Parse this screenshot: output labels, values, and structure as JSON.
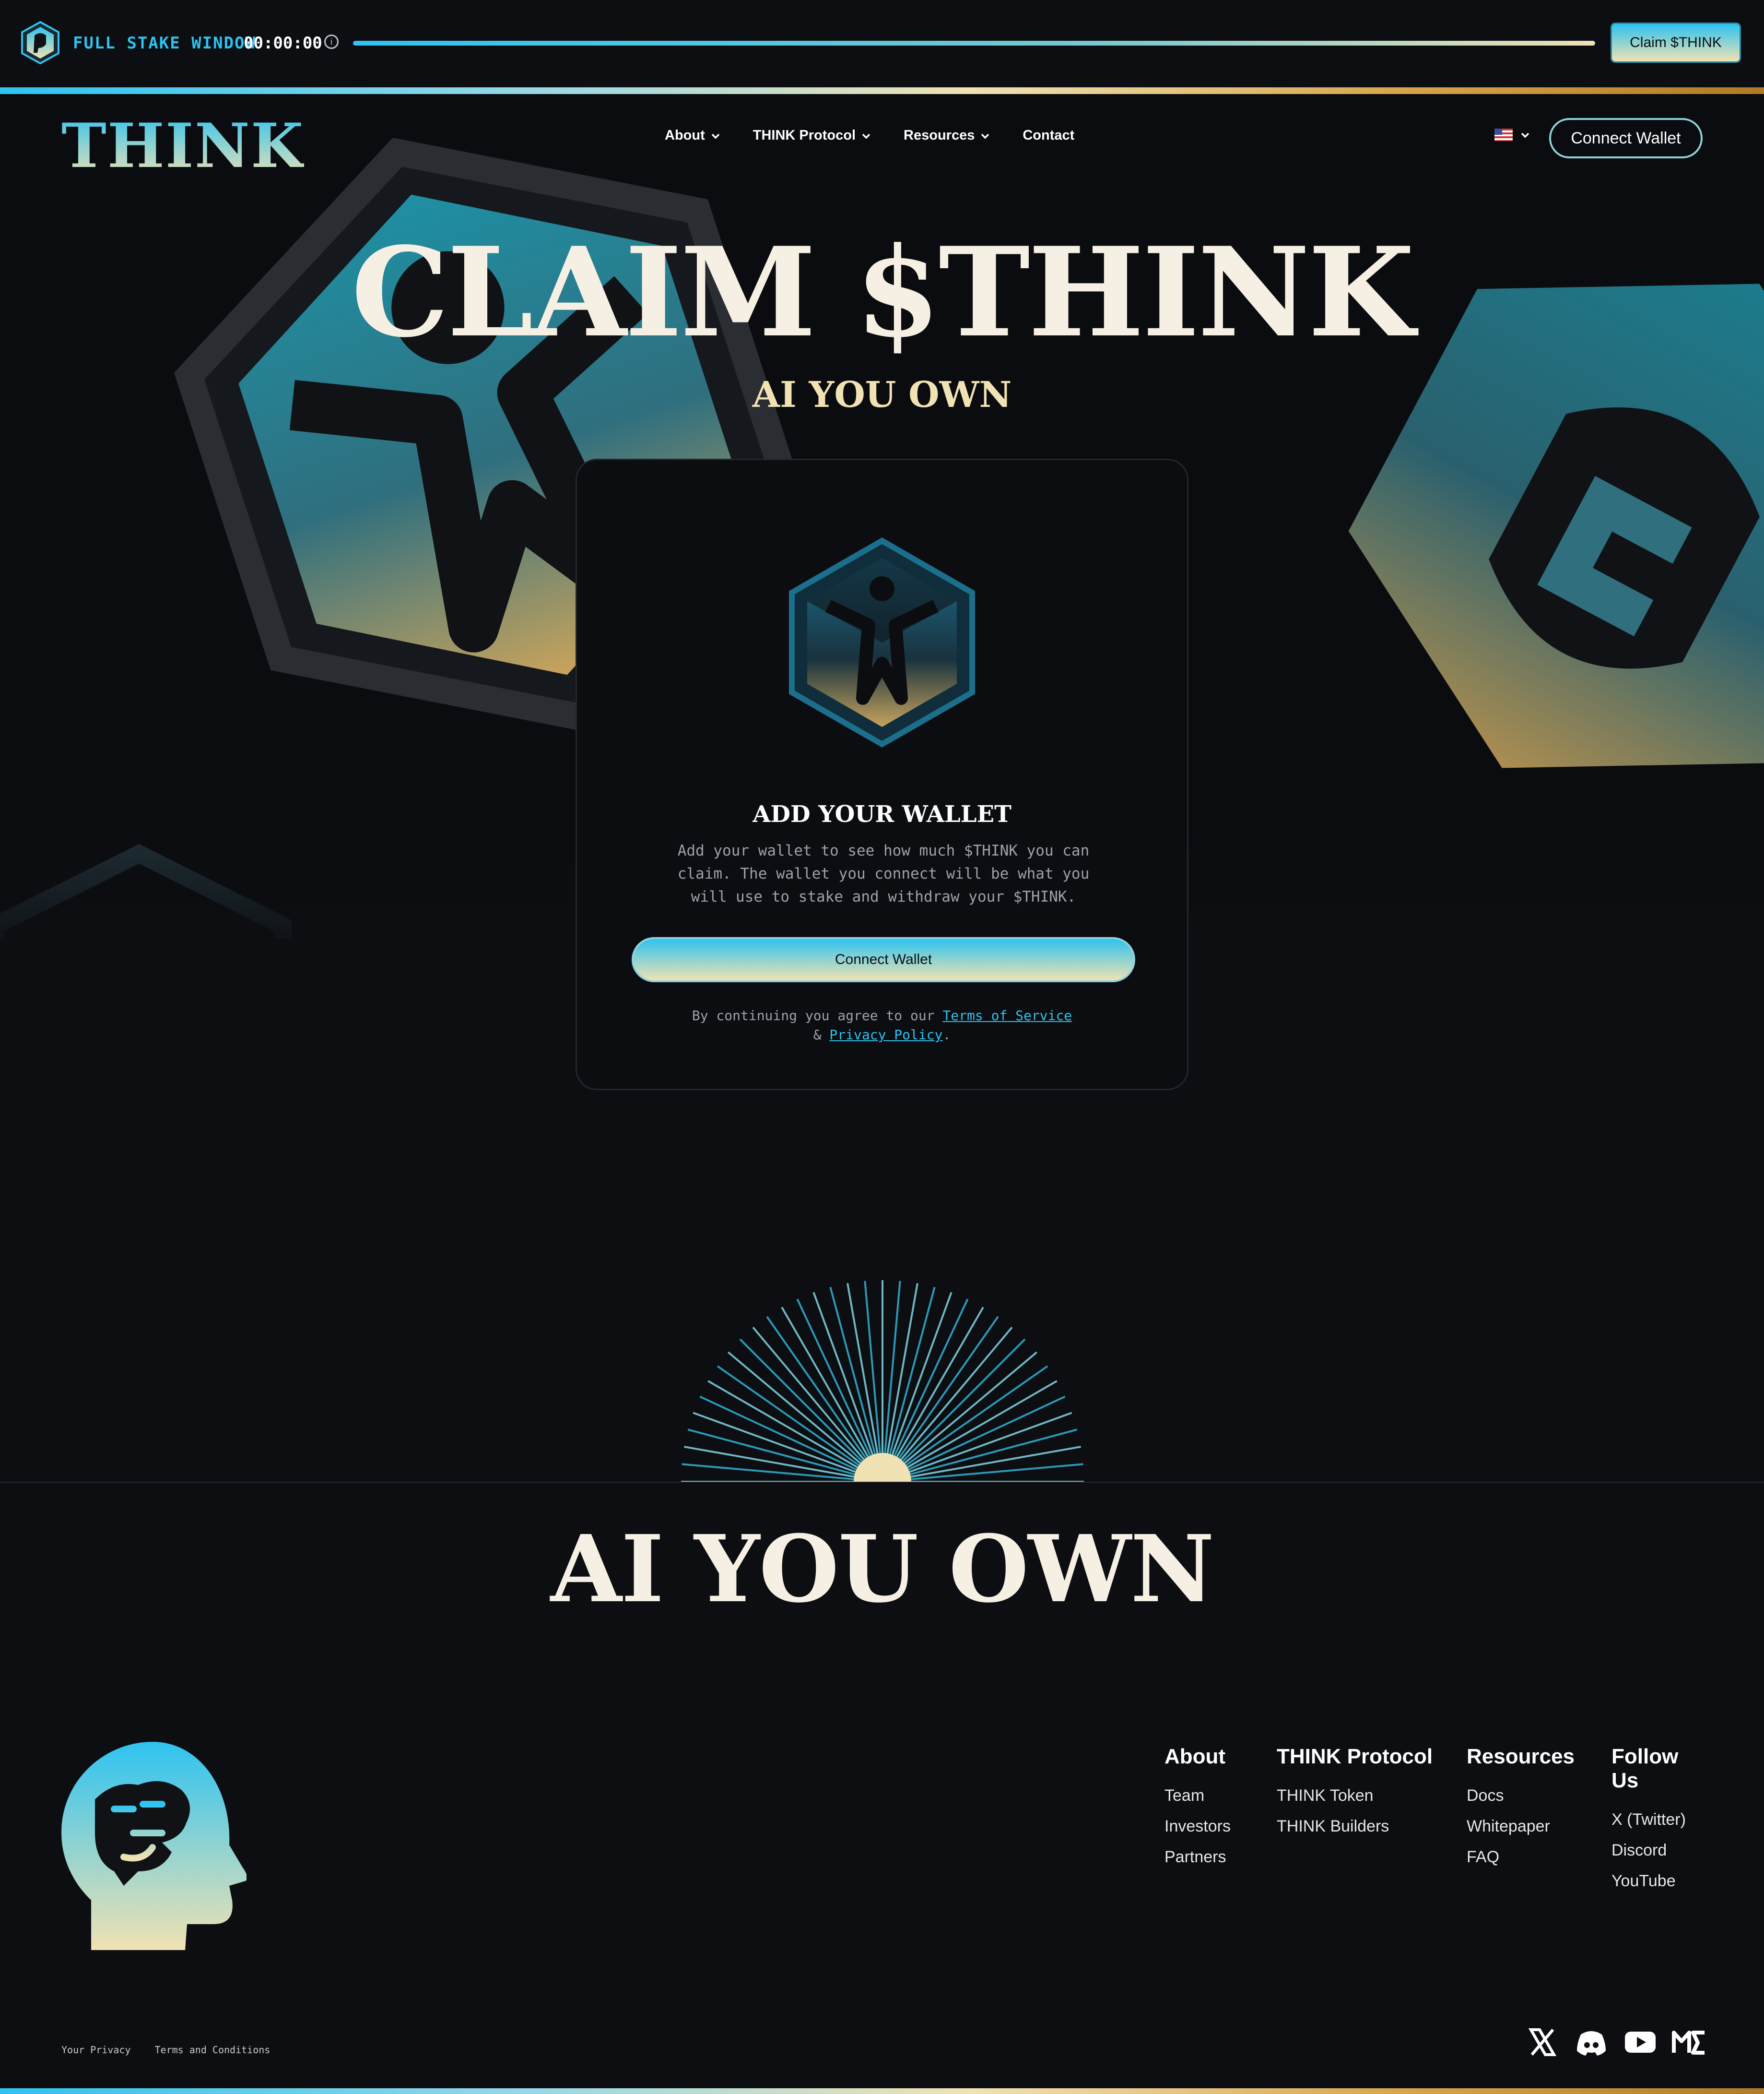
{
  "stake_bar": {
    "label": "FULL STAKE WINDOW",
    "timer": "00:00:00",
    "info_glyph": "i",
    "claim_button": "Claim $THINK",
    "progress": 1.0
  },
  "nav": {
    "brand": "THINK",
    "items": [
      {
        "label": "About",
        "has_dropdown": true
      },
      {
        "label": "THINK Protocol",
        "has_dropdown": true
      },
      {
        "label": "Resources",
        "has_dropdown": true
      },
      {
        "label": "Contact",
        "has_dropdown": false
      }
    ],
    "language_icon": "us-flag-icon",
    "connect_button": "Connect Wallet"
  },
  "hero": {
    "title": "CLAIM $THINK",
    "subtitle": "AI YOU OWN"
  },
  "card": {
    "icon": "think-hex-person-icon",
    "title": "ADD YOUR WALLET",
    "text": "Add your wallet to see how much $THINK you can claim. The wallet you connect will be what you will use to stake and withdraw your $THINK.",
    "button": "Connect Wallet",
    "legal_prefix": "By continuing you agree to our",
    "terms_link": "Terms of Service",
    "legal_mid": "&",
    "privacy_link": "Privacy Policy",
    "legal_suffix": "."
  },
  "tagline": "AI YOU OWN",
  "footer": {
    "columns": [
      {
        "title": "About",
        "links": [
          "Team",
          "Investors",
          "Partners"
        ]
      },
      {
        "title": "THINK Protocol",
        "links": [
          "THINK Token",
          "THINK Builders"
        ]
      },
      {
        "title": "Resources",
        "links": [
          "Docs",
          "Whitepaper",
          "FAQ"
        ]
      },
      {
        "title": "Follow Us",
        "links": [
          "X (Twitter)",
          "Discord",
          "YouTube"
        ]
      }
    ],
    "legal_links": [
      "Your Privacy",
      "Terms and Conditions"
    ],
    "social_icons": [
      "x-icon",
      "discord-icon",
      "youtube-icon",
      "magic-eden-icon"
    ]
  },
  "colors": {
    "accent_cyan": "#2ec3f0",
    "accent_cream": "#f0e2b3",
    "accent_gold": "#d7a34a",
    "background": "#0c0e12"
  }
}
